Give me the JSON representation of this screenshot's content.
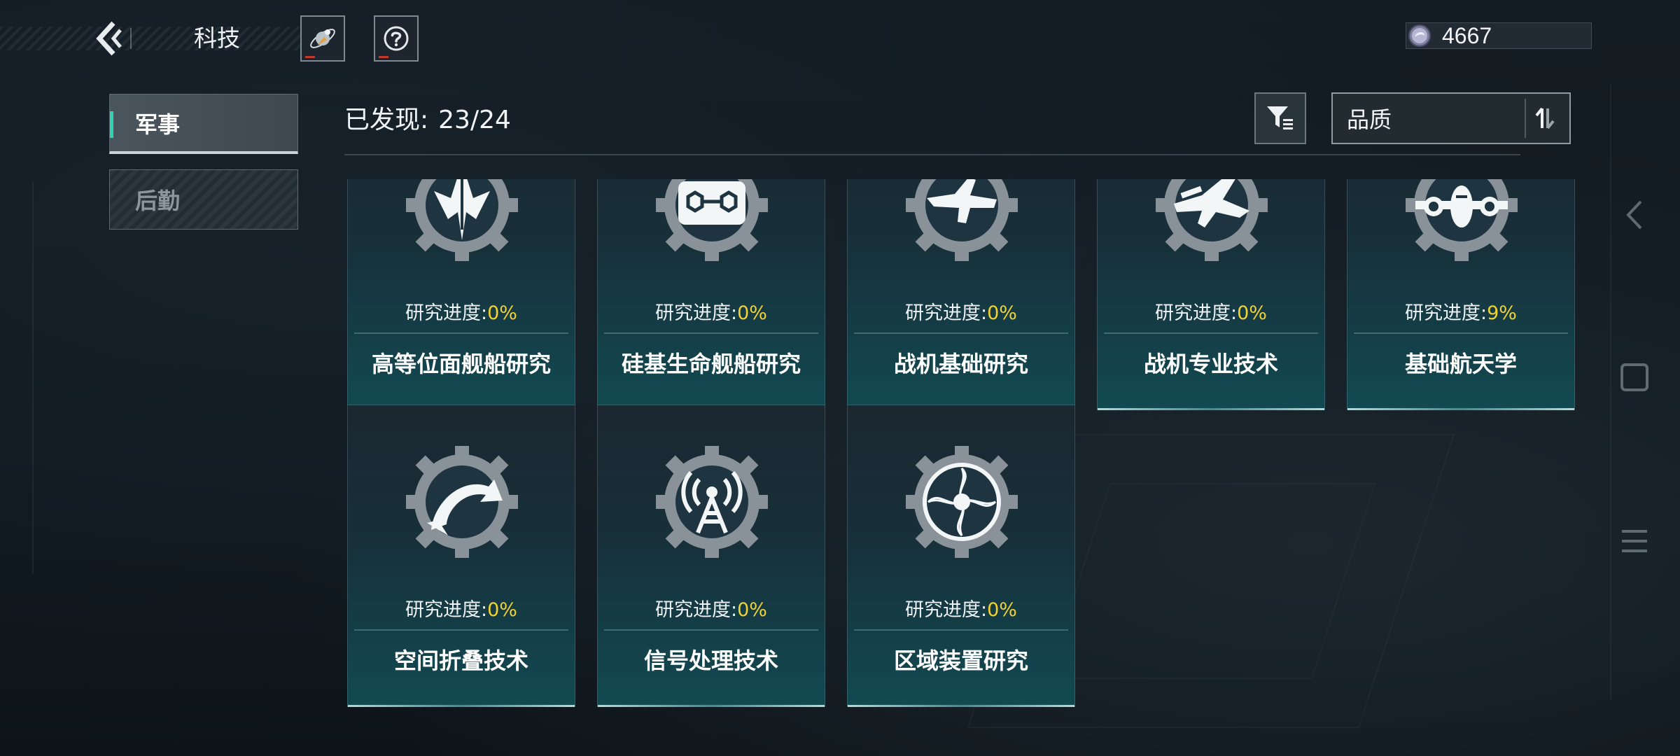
{
  "header": {
    "title": "科技",
    "currency_amount": "4667"
  },
  "sidebar": {
    "tabs": [
      {
        "label": "军事",
        "active": true
      },
      {
        "label": "后勤",
        "active": false
      }
    ]
  },
  "toolbar": {
    "discovered_label": "已发现:",
    "discovered_count": "23/24",
    "sort_label": "品质"
  },
  "cards": [
    {
      "icon": "warship-gear-icon",
      "progress_label": "研究进度:",
      "progress_value": "0%",
      "name": "高等位面舰船研究"
    },
    {
      "icon": "hexagon-molecule-gear-icon",
      "progress_label": "研究进度:",
      "progress_value": "0%",
      "name": "硅基生命舰船研究"
    },
    {
      "icon": "fighter-jet-gear-icon",
      "progress_label": "研究进度:",
      "progress_value": "0%",
      "name": "战机基础研究"
    },
    {
      "icon": "fighter-missile-gear-icon",
      "progress_label": "研究进度:",
      "progress_value": "0%",
      "name": "战机专业技术"
    },
    {
      "icon": "airliner-gear-icon",
      "progress_label": "研究进度:",
      "progress_value": "9%",
      "name": "基础航天学"
    },
    {
      "icon": "space-fold-gear-icon",
      "progress_label": "研究进度:",
      "progress_value": "0%",
      "name": "空间折叠技术"
    },
    {
      "icon": "signal-tower-gear-icon",
      "progress_label": "研究进度:",
      "progress_value": "0%",
      "name": "信号处理技术"
    },
    {
      "icon": "vortex-device-gear-icon",
      "progress_label": "研究进度:",
      "progress_value": "0%",
      "name": "区域装置研究"
    }
  ],
  "colors": {
    "accent": "#2fd3b4",
    "progress_value": "#f2d233",
    "card_bottom": "#124a52"
  }
}
